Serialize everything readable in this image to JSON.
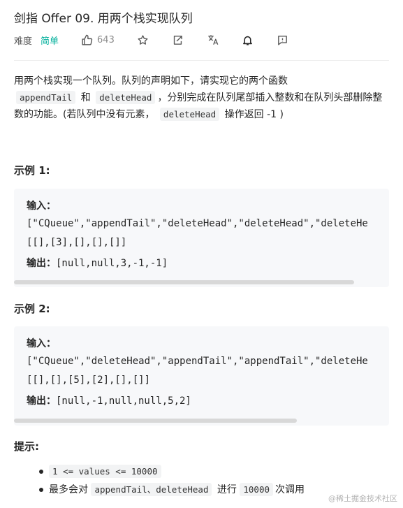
{
  "problem": {
    "title": "剑指 Offer 09. 用两个栈实现队列",
    "difficulty_label": "难度",
    "difficulty": "简单",
    "likes": "643"
  },
  "icons": [
    "thumbs-up-icon",
    "star-icon",
    "share-icon",
    "translate-icon",
    "bell-icon",
    "feedback-icon"
  ],
  "description": {
    "p1": "用两个栈实现一个队列。队列的声明如下，请实现它的两个函数",
    "code1": "appendTail",
    "and": "和",
    "code2": "deleteHead",
    "p2": "，分别完成在队列尾部插入整数和在队列头部删除整数的功能。(若队列中没有元素，",
    "code3": "deleteHead",
    "p3": "操作返回 -1 )"
  },
  "example1": {
    "heading": "示例 1:",
    "input_label": "输入：",
    "line1": "[\"CQueue\",\"appendTail\",\"deleteHead\",\"deleteHead\",\"deleteHe",
    "line2": "[[],[3],[],[],[]]",
    "output_label": "输出：",
    "output": "[null,null,3,-1,-1]"
  },
  "example2": {
    "heading": "示例 2:",
    "input_label": "输入：",
    "line1": "[\"CQueue\",\"deleteHead\",\"appendTail\",\"appendTail\",\"deleteHe",
    "line2": "[[],[],[5],[2],[],[]]",
    "output_label": "输出：",
    "output": "[null,-1,null,null,5,2]"
  },
  "tips": {
    "heading": "提示:",
    "item1_code": "1 <= values <= 10000",
    "item2_prefix": "最多会对",
    "item2_code": "appendTail、deleteHead",
    "item2_mid": "进行",
    "item2_count": "10000",
    "item2_suffix": "次调用"
  },
  "watermark": "@稀土掘金技术社区"
}
